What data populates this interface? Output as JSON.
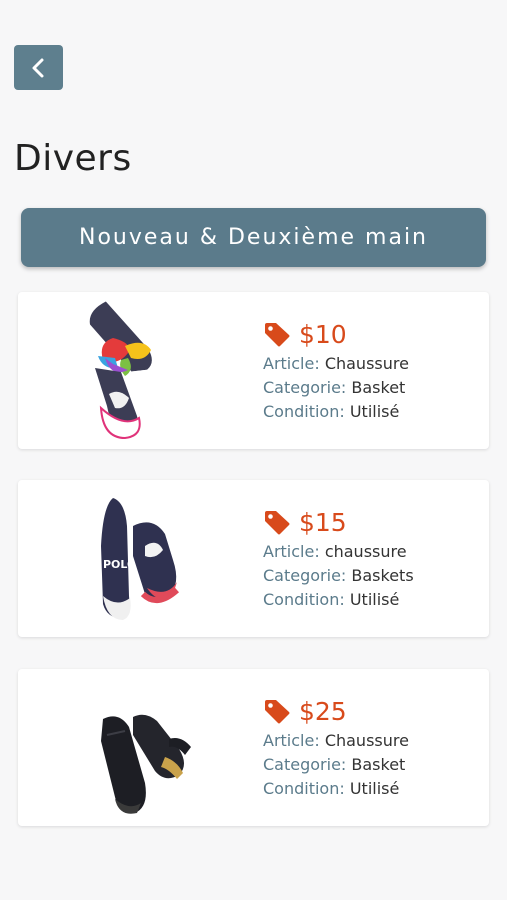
{
  "header": {
    "title": "Divers",
    "back_icon": "chevron-left-icon"
  },
  "category_button": {
    "label": "Nouveau & Deuxième main"
  },
  "field_labels": {
    "article": "Article:",
    "category": "Categorie:",
    "condition": "Condition:"
  },
  "colors": {
    "accent": "#5b7b8b",
    "price": "#d84a1b"
  },
  "products": [
    {
      "price": "$10",
      "article": "Chaussure",
      "category": "Basket",
      "condition": "Utilisé",
      "image": "sneaker-rainbow-laces"
    },
    {
      "price": "$15",
      "article": "chaussure",
      "category": "Baskets",
      "condition": "Utilisé",
      "image": "sneaker-polo-navy"
    },
    {
      "price": "$25",
      "article": "Chaussure",
      "category": "Basket",
      "condition": "Utilisé",
      "image": "sneaker-black-slipon"
    }
  ]
}
